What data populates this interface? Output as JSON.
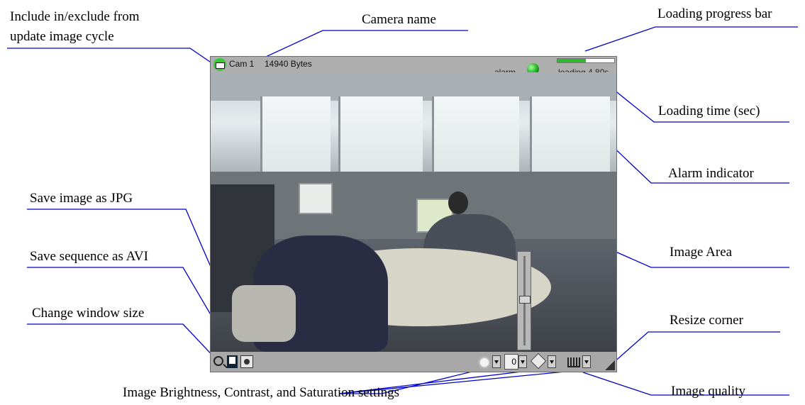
{
  "window": {
    "camera_name": "Cam 1",
    "bytes": "14940 Bytes",
    "alarm_text": "alarm",
    "loading_text": "loading 4.80s",
    "progress_fraction": 0.5,
    "contrast_value": "0"
  },
  "colors": {
    "alarm": "#14a514",
    "progress_fill": "#2db82d",
    "callout_line": "#0000cc"
  },
  "callouts": {
    "include_cycle_1": "Include in/exclude from",
    "include_cycle_2": "update image cycle",
    "camera_name": "Camera name",
    "progress_bar": "Loading progress bar",
    "loading_time": "Loading time (sec)",
    "alarm_indicator": "Alarm indicator",
    "save_jpg": "Save image as JPG",
    "save_avi": "Save sequence as AVI",
    "image_area": "Image Area",
    "window_size": "Change window size",
    "resize_corner": "Resize corner",
    "bcs_settings": "Image Brightness, Contrast, and Saturation settings",
    "image_quality": "Image quality"
  },
  "icons": [
    "cycle-toggle-icon",
    "alarm-indicator-icon",
    "zoom-icon",
    "jpg-save-icon",
    "avi-save-icon",
    "brightness-icon",
    "saturation-icon",
    "quality-icon"
  ]
}
